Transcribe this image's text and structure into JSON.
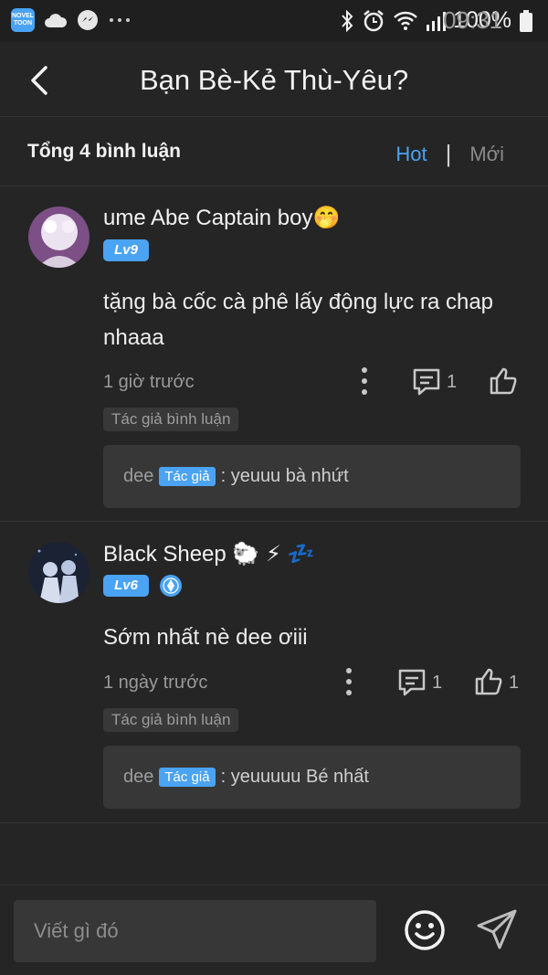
{
  "status_bar": {
    "app_badge": "NOVEL TOON",
    "battery": "100%",
    "time": "09:31"
  },
  "header": {
    "title": "Bạn Bè-Kẻ Thù-Yêu?"
  },
  "summary": {
    "total": "Tổng 4 bình luận",
    "sort_hot": "Hot",
    "sort_new": "Mới"
  },
  "comments": [
    {
      "username": "ume Abe Captain boy🤭",
      "level": "Lv9",
      "text": "tặng bà cốc cà phê lấy động lực ra chap nhaaa",
      "time": "1 giờ trước",
      "reply_count": "1",
      "like_count": "",
      "author_tag": "Tác giả bình luận",
      "reply": {
        "name": "dee",
        "tag": "Tác giả",
        "text": ": yeuuu bà nhứt"
      }
    },
    {
      "username": "Black Sheep 🐑 ⚡ 💤",
      "level": "Lv6",
      "text": "Sớm nhất nè dee ơiii",
      "time": "1 ngày trước",
      "reply_count": "1",
      "like_count": "1",
      "author_tag": "Tác giả bình luận",
      "reply": {
        "name": "dee",
        "tag": "Tác giả",
        "text": ": yeuuuuu Bé nhất"
      }
    }
  ],
  "input": {
    "placeholder": "Viết gì đó"
  },
  "colors": {
    "accent": "#4aa3f3",
    "background": "#252525",
    "reply_bg": "#373737"
  }
}
